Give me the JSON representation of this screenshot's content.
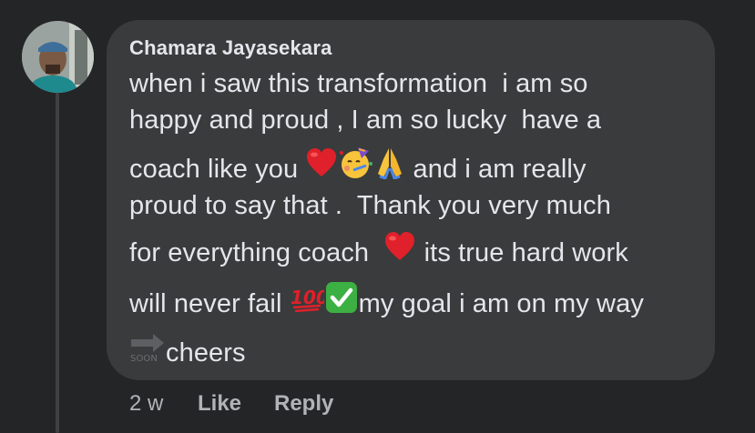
{
  "comment": {
    "author": "Chamara Jayasekara",
    "lines": [
      "when i saw this transformation  i am so",
      "happy and proud , I am so lucky  have a",
      "coach like you ",
      " and i am really",
      "proud to say that .  Thank you very much",
      "for everything coach  ",
      " its true hard work",
      "will never fail ",
      "my goal i am on my way",
      "cheers"
    ],
    "emoji_soon_text": "SOON",
    "time": "2 w",
    "like_label": "Like",
    "reply_label": "Reply"
  },
  "icons": [
    "avatar-photo",
    "red-heart-emoji",
    "party-face-emoji",
    "folded-hands-emoji",
    "hundred-points-emoji",
    "check-mark-button-emoji",
    "soon-arrow-emoji"
  ],
  "colors": {
    "background": "#242526",
    "bubble": "#3a3b3c",
    "text": "#e4e6eb",
    "meta": "#b0b3b8"
  }
}
